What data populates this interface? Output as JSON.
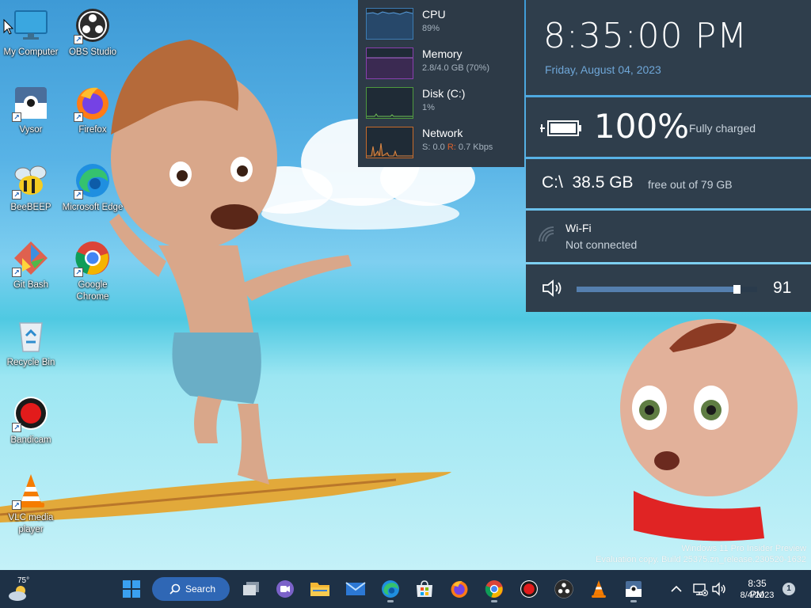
{
  "desktop": {
    "icons": [
      {
        "label": "My Computer"
      },
      {
        "label": "OBS Studio"
      },
      {
        "label": "Vysor"
      },
      {
        "label": "Firefox"
      },
      {
        "label": "BeeBEEP"
      },
      {
        "label": "Microsoft Edge"
      },
      {
        "label": "Git Bash"
      },
      {
        "label": "Google Chrome"
      },
      {
        "label": "Recycle Bin"
      },
      {
        "label": "Bandicam"
      },
      {
        "label": "VLC media player"
      }
    ]
  },
  "monitor": {
    "cpu": {
      "title": "CPU",
      "value": "89%"
    },
    "memory": {
      "title": "Memory",
      "value": "2.8/4.0 GB (70%)"
    },
    "disk": {
      "title": "Disk (C:)",
      "value": "1%"
    },
    "network": {
      "title": "Network",
      "send_label": "S:",
      "send_value": "0.0",
      "recv_label": "R:",
      "recv_value": "0.7 Kbps"
    }
  },
  "clock": {
    "time": "8:35:00 PM",
    "date": "Friday, August 04, 2023"
  },
  "battery": {
    "percent": "100%",
    "status": "Fully charged",
    "level": 1.0
  },
  "drive": {
    "label": "C:\\  38.5 GB",
    "free_text": "free out of 79 GB"
  },
  "wifi": {
    "title": "Wi-Fi",
    "status": "Not connected"
  },
  "volume": {
    "value": "91",
    "level": 0.91
  },
  "watermark": {
    "line1": "Windows 11 Pro Insider Preview",
    "line2": "Evaluation copy. Build 25375.zn_release.230520-1632"
  },
  "taskbar": {
    "weather_temp": "75°",
    "search_label": "Search",
    "time": "8:35 PM",
    "date": "8/4/2023",
    "notification_count": "1"
  },
  "colors": {
    "cpu": "#3d7cb3",
    "memory": "#8a3fb0",
    "disk": "#4f9a3e",
    "network": "#c86b2a",
    "taskbar": "#1e3146",
    "accent": "#2f67b5"
  }
}
